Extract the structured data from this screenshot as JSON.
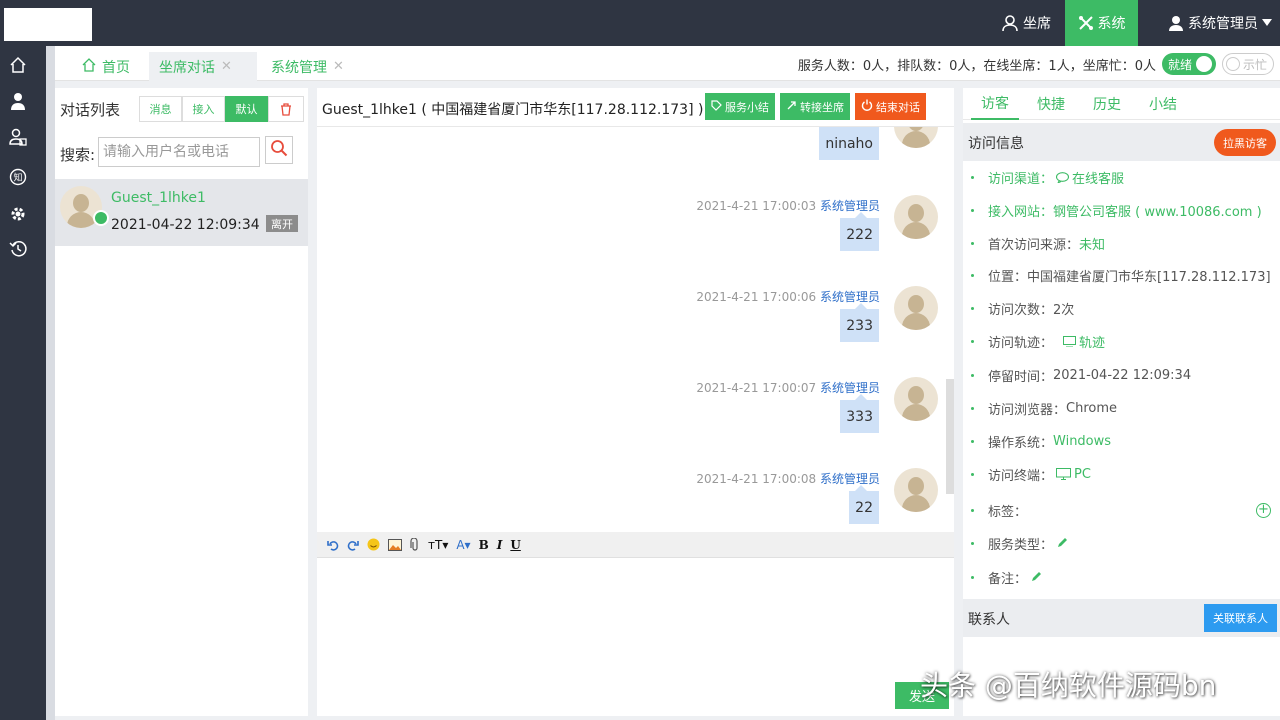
{
  "header": {
    "nav": [
      {
        "label": "坐席",
        "icon": "user-outline-icon"
      },
      {
        "label": "系统",
        "icon": "tools-icon"
      },
      {
        "label": "系统管理员",
        "icon": "user-icon"
      }
    ]
  },
  "rail": {
    "icons": [
      "home-icon",
      "person-icon",
      "user-card-icon",
      "knowledge-icon",
      "gear-icon",
      "history-icon"
    ]
  },
  "tabs": [
    {
      "label": "首页",
      "closable": false
    },
    {
      "label": "坐席对话",
      "closable": true
    },
    {
      "label": "系统管理",
      "closable": true
    }
  ],
  "stats": {
    "text": "服务人数：0人，排队数：0人，在线坐席：1人，坐席忙：0人",
    "toggle_ready": "就绪",
    "toggle_busy": "示忙"
  },
  "conversation_list": {
    "title": "对话列表",
    "filters": [
      "消息",
      "接入",
      "默认"
    ],
    "search_label": "搜索:",
    "search_placeholder": "请输入用户名或电话",
    "items": [
      {
        "name": "Guest_1lhke1",
        "time": "2021-04-22 12:09:34",
        "status": "离开"
      }
    ]
  },
  "chat": {
    "title": "Guest_1lhke1 ( 中国福建省厦门市华东[117.28.112.173] )",
    "actions": [
      "服务小结",
      "转接坐席",
      "结束对话"
    ],
    "messages": [
      {
        "time": "",
        "sender": "",
        "text": "ninaho"
      },
      {
        "time": "2021-4-21 17:00:03",
        "sender": "系统管理员",
        "text": "222"
      },
      {
        "time": "2021-4-21 17:00:06",
        "sender": "系统管理员",
        "text": "233"
      },
      {
        "time": "2021-4-21 17:00:07",
        "sender": "系统管理员",
        "text": "333"
      },
      {
        "time": "2021-4-21 17:00:08",
        "sender": "系统管理员",
        "text": "22"
      }
    ],
    "send_label": "发送"
  },
  "info": {
    "tabs": [
      "访客",
      "快捷",
      "历史",
      "小结"
    ],
    "visit_section_title": "访问信息",
    "blacklist_label": "拉黑访客",
    "fields": [
      {
        "label": "访问渠道：",
        "value": "在线客服",
        "green": true,
        "icon": "chat-bubble-icon"
      },
      {
        "label": "接入网站：",
        "value": "钢管公司客服 ( www.10086.com )",
        "green": true
      },
      {
        "label": "首次访问来源： ",
        "value": "未知",
        "green": true
      },
      {
        "label": "位置：",
        "value": "中国福建省厦门市华东[117.28.112.173]",
        "green": false
      },
      {
        "label": "访问次数：",
        "value": "2次",
        "green": false
      },
      {
        "label": "访问轨迹： ",
        "value": "轨迹",
        "green": true,
        "icon": "track-icon"
      },
      {
        "label": "停留时间： ",
        "value": "2021-04-22 12:09:34",
        "green": false
      },
      {
        "label": "访问浏览器： ",
        "value": "Chrome",
        "green": false
      },
      {
        "label": "操作系统： ",
        "value": "Windows",
        "green": true
      },
      {
        "label": "访问终端： ",
        "value": "PC",
        "green": true,
        "icon": "monitor-icon"
      },
      {
        "label": "标签：",
        "value": "",
        "green": false
      },
      {
        "label": "服务类型：",
        "value": "",
        "green": false,
        "icon": "pencil-icon"
      },
      {
        "label": "备注：",
        "value": "",
        "green": false,
        "icon": "pencil-icon"
      }
    ],
    "contact_section_title": "联系人",
    "link_contact_label": "关联联系人"
  },
  "watermark": "头条 @百纳软件源码bn",
  "colors": {
    "accent": "#3dbb65",
    "danger": "#f0591d",
    "info": "#2d9bf0",
    "dark": "#2f3542"
  }
}
